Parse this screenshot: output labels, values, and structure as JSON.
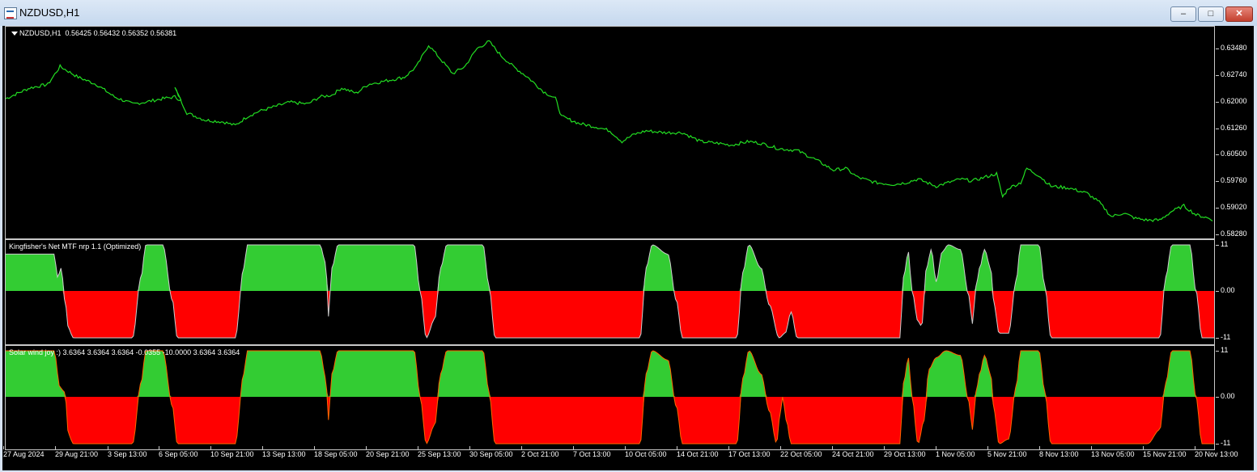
{
  "window": {
    "title": "NZDUSD,H1",
    "controls": {
      "minimize": "–",
      "maximize": "□",
      "close": "✕"
    }
  },
  "main_pane": {
    "label": "NZDUSD,H1",
    "ohlc": "0.56425 0.56432 0.56352 0.56381",
    "line_color": "#22dd22",
    "y_ticks": [
      "0.63480",
      "0.62740",
      "0.62000",
      "0.61260",
      "0.60500",
      "0.59760",
      "0.59020",
      "0.58280"
    ],
    "y_min": 0.5828,
    "y_max": 0.6348
  },
  "indicator1": {
    "label": "Kingfisher's Net MTF nrp 1.1 (Optimized)",
    "y_ticks": [
      "11",
      "0.00",
      "-11"
    ]
  },
  "indicator2": {
    "label": "Solar wind joy :)",
    "values": "3.6364 3.6364 3.6364 -0.0355 -10.0000 3.6364 3.6364",
    "y_ticks": [
      "11",
      "0.00",
      "-11"
    ]
  },
  "colors": {
    "positive": "#33cc33",
    "negative": "#ff0000",
    "edge1": "#cccccc",
    "edge2": "#ff6600"
  },
  "x_labels": [
    "27 Aug 2024",
    "29 Aug 21:00",
    "3 Sep 13:00",
    "6 Sep 05:00",
    "10 Sep 21:00",
    "13 Sep 13:00",
    "18 Sep 05:00",
    "20 Sep 21:00",
    "25 Sep 13:00",
    "30 Sep 05:00",
    "2 Oct 21:00",
    "7 Oct 13:00",
    "10 Oct 05:00",
    "14 Oct 21:00",
    "17 Oct 13:00",
    "22 Oct 05:00",
    "24 Oct 21:00",
    "29 Oct 13:00",
    "1 Nov 05:00",
    "5 Nov 21:00",
    "8 Nov 13:00",
    "13 Nov 05:00",
    "15 Nov 21:00",
    "20 Nov 13:00"
  ],
  "chart_data": [
    {
      "type": "line",
      "series": [
        {
          "name": "NZDUSD,H1",
          "points": [
            [
              0,
              0.621
            ],
            [
              0.02,
              0.624
            ],
            [
              0.035,
              0.625
            ],
            [
              0.045,
              0.63
            ],
            [
              0.06,
              0.627
            ],
            [
              0.075,
              0.625
            ],
            [
              0.09,
              0.6215
            ],
            [
              0.105,
              0.6195
            ],
            [
              0.115,
              0.62
            ],
            [
              0.13,
              0.621
            ],
            [
              0.14,
              0.6215
            ],
            [
              0.145,
              0.6205
            ],
            [
              0.14,
              0.624
            ],
            [
              0.15,
              0.617
            ],
            [
              0.165,
              0.615
            ],
            [
              0.18,
              0.6145
            ],
            [
              0.19,
              0.6135
            ],
            [
              0.2,
              0.616
            ],
            [
              0.21,
              0.6175
            ],
            [
              0.22,
              0.6185
            ],
            [
              0.235,
              0.62
            ],
            [
              0.25,
              0.6195
            ],
            [
              0.26,
              0.6215
            ],
            [
              0.27,
              0.622
            ],
            [
              0.278,
              0.624
            ],
            [
              0.29,
              0.6225
            ],
            [
              0.3,
              0.625
            ],
            [
              0.315,
              0.626
            ],
            [
              0.33,
              0.627
            ],
            [
              0.34,
              0.63
            ],
            [
              0.35,
              0.636
            ],
            [
              0.36,
              0.632
            ],
            [
              0.37,
              0.628
            ],
            [
              0.38,
              0.63
            ],
            [
              0.39,
              0.635
            ],
            [
              0.4,
              0.637
            ],
            [
              0.41,
              0.633
            ],
            [
              0.42,
              0.63
            ],
            [
              0.432,
              0.627
            ],
            [
              0.445,
              0.623
            ],
            [
              0.455,
              0.621
            ],
            [
              0.46,
              0.616
            ],
            [
              0.475,
              0.614
            ],
            [
              0.49,
              0.613
            ],
            [
              0.5,
              0.612
            ],
            [
              0.51,
              0.609
            ],
            [
              0.52,
              0.611
            ],
            [
              0.53,
              0.612
            ],
            [
              0.545,
              0.6115
            ],
            [
              0.56,
              0.6115
            ],
            [
              0.575,
              0.609
            ],
            [
              0.59,
              0.6085
            ],
            [
              0.6,
              0.608
            ],
            [
              0.615,
              0.609
            ],
            [
              0.625,
              0.6085
            ],
            [
              0.64,
              0.607
            ],
            [
              0.655,
              0.6065
            ],
            [
              0.67,
              0.604
            ],
            [
              0.685,
              0.601
            ],
            [
              0.695,
              0.6015
            ],
            [
              0.705,
              0.599
            ],
            [
              0.72,
              0.5975
            ],
            [
              0.735,
              0.597
            ],
            [
              0.745,
              0.5975
            ],
            [
              0.755,
              0.5985
            ],
            [
              0.77,
              0.5965
            ],
            [
              0.78,
              0.5975
            ],
            [
              0.79,
              0.5985
            ],
            [
              0.8,
              0.598
            ],
            [
              0.81,
              0.599
            ],
            [
              0.82,
              0.6
            ],
            [
              0.825,
              0.5935
            ],
            [
              0.83,
              0.596
            ],
            [
              0.84,
              0.5975
            ],
            [
              0.845,
              0.6015
            ],
            [
              0.855,
              0.5995
            ],
            [
              0.865,
              0.5965
            ],
            [
              0.88,
              0.596
            ],
            [
              0.895,
              0.5945
            ],
            [
              0.905,
              0.592
            ],
            [
              0.915,
              0.588
            ],
            [
              0.925,
              0.589
            ],
            [
              0.935,
              0.5875
            ],
            [
              0.945,
              0.587
            ],
            [
              0.955,
              0.587
            ],
            [
              0.965,
              0.5895
            ],
            [
              0.975,
              0.591
            ],
            [
              0.985,
              0.5885
            ],
            [
              0.993,
              0.5878
            ],
            [
              1.0,
              0.587
            ]
          ]
        }
      ]
    },
    {
      "type": "area",
      "title": "Kingfisher's Net MTF nrp 1.1 (Optimized)",
      "ylim": [
        -11,
        11
      ],
      "series": [
        {
          "points": [
            [
              0,
              0.8
            ],
            [
              0.04,
              0.8
            ],
            [
              0.043,
              0.3
            ],
            [
              0.046,
              0.5
            ],
            [
              0.049,
              -0.2
            ],
            [
              0.052,
              -0.8
            ],
            [
              0.056,
              -1
            ],
            [
              0.105,
              -1
            ],
            [
              0.112,
              0.3
            ],
            [
              0.116,
              1
            ],
            [
              0.13,
              1
            ],
            [
              0.138,
              -0.2
            ],
            [
              0.142,
              -1
            ],
            [
              0.19,
              -1
            ],
            [
              0.197,
              0.5
            ],
            [
              0.2,
              1
            ],
            [
              0.26,
              1
            ],
            [
              0.265,
              0.6
            ],
            [
              0.267,
              -0.55
            ],
            [
              0.27,
              0.5
            ],
            [
              0.275,
              1
            ],
            [
              0.338,
              1
            ],
            [
              0.343,
              0
            ],
            [
              0.348,
              -1
            ],
            [
              0.355,
              -0.6
            ],
            [
              0.36,
              0.5
            ],
            [
              0.365,
              1
            ],
            [
              0.395,
              1
            ],
            [
              0.4,
              0.1
            ],
            [
              0.405,
              -1
            ],
            [
              0.525,
              -1
            ],
            [
              0.53,
              0.5
            ],
            [
              0.535,
              1
            ],
            [
              0.548,
              0.8
            ],
            [
              0.555,
              -0.2
            ],
            [
              0.56,
              -1
            ],
            [
              0.605,
              -1
            ],
            [
              0.61,
              0.4
            ],
            [
              0.615,
              1
            ],
            [
              0.625,
              0.5
            ],
            [
              0.632,
              -0.3
            ],
            [
              0.64,
              -1
            ],
            [
              0.645,
              -0.9
            ],
            [
              0.65,
              -0.45
            ],
            [
              0.655,
              -1
            ],
            [
              0.74,
              -1
            ],
            [
              0.743,
              0.3
            ],
            [
              0.747,
              0.85
            ],
            [
              0.75,
              0
            ],
            [
              0.755,
              -0.65
            ],
            [
              0.758,
              -0.75
            ],
            [
              0.762,
              0.5
            ],
            [
              0.766,
              0.9
            ],
            [
              0.77,
              0.2
            ],
            [
              0.775,
              0.85
            ],
            [
              0.78,
              1
            ],
            [
              0.79,
              0.9
            ],
            [
              0.797,
              -0.1
            ],
            [
              0.8,
              -0.7
            ],
            [
              0.803,
              0.1
            ],
            [
              0.806,
              0.5
            ],
            [
              0.81,
              0.9
            ],
            [
              0.815,
              0.5
            ],
            [
              0.818,
              -0.3
            ],
            [
              0.822,
              -0.9
            ],
            [
              0.83,
              -0.9
            ],
            [
              0.836,
              0.2
            ],
            [
              0.84,
              1
            ],
            [
              0.855,
              1
            ],
            [
              0.86,
              0.1
            ],
            [
              0.865,
              -1
            ],
            [
              0.955,
              -1
            ],
            [
              0.96,
              0.3
            ],
            [
              0.965,
              1
            ],
            [
              0.98,
              1
            ],
            [
              0.985,
              0
            ],
            [
              0.99,
              -1
            ],
            [
              1.0,
              -1
            ]
          ]
        }
      ]
    },
    {
      "type": "area",
      "title": "Solar wind joy :)",
      "ylim": [
        -11,
        11
      ],
      "series": [
        {
          "points": [
            [
              0,
              1
            ],
            [
              0.04,
              1
            ],
            [
              0.045,
              0.2
            ],
            [
              0.049,
              0.1
            ],
            [
              0.052,
              -0.8
            ],
            [
              0.056,
              -1
            ],
            [
              0.105,
              -1
            ],
            [
              0.112,
              0.3
            ],
            [
              0.116,
              1
            ],
            [
              0.13,
              1
            ],
            [
              0.138,
              -0.2
            ],
            [
              0.142,
              -1
            ],
            [
              0.19,
              -1
            ],
            [
              0.197,
              0.5
            ],
            [
              0.2,
              1
            ],
            [
              0.26,
              1
            ],
            [
              0.265,
              0.4
            ],
            [
              0.267,
              -0.5
            ],
            [
              0.27,
              0.5
            ],
            [
              0.275,
              1
            ],
            [
              0.338,
              1
            ],
            [
              0.343,
              0
            ],
            [
              0.348,
              -1
            ],
            [
              0.355,
              -0.6
            ],
            [
              0.36,
              0.5
            ],
            [
              0.365,
              1
            ],
            [
              0.395,
              1
            ],
            [
              0.4,
              0.1
            ],
            [
              0.405,
              -1
            ],
            [
              0.525,
              -1
            ],
            [
              0.53,
              0.5
            ],
            [
              0.535,
              1
            ],
            [
              0.548,
              0.8
            ],
            [
              0.555,
              -0.2
            ],
            [
              0.56,
              -1
            ],
            [
              0.605,
              -1
            ],
            [
              0.61,
              0.4
            ],
            [
              0.615,
              1
            ],
            [
              0.625,
              0.5
            ],
            [
              0.632,
              -0.3
            ],
            [
              0.638,
              -1
            ],
            [
              0.64,
              -0.5
            ],
            [
              0.643,
              0
            ],
            [
              0.646,
              -0.5
            ],
            [
              0.65,
              -1
            ],
            [
              0.74,
              -1
            ],
            [
              0.743,
              0.3
            ],
            [
              0.747,
              0.85
            ],
            [
              0.75,
              0
            ],
            [
              0.755,
              -1
            ],
            [
              0.76,
              -0.5
            ],
            [
              0.764,
              0.6
            ],
            [
              0.77,
              0.85
            ],
            [
              0.778,
              1
            ],
            [
              0.79,
              0.9
            ],
            [
              0.797,
              -0.1
            ],
            [
              0.8,
              -0.7
            ],
            [
              0.803,
              0.1
            ],
            [
              0.806,
              0.5
            ],
            [
              0.81,
              0.9
            ],
            [
              0.815,
              0.5
            ],
            [
              0.818,
              -0.3
            ],
            [
              0.822,
              -1
            ],
            [
              0.83,
              -0.9
            ],
            [
              0.836,
              0.2
            ],
            [
              0.84,
              1
            ],
            [
              0.855,
              1
            ],
            [
              0.86,
              0.1
            ],
            [
              0.865,
              -1
            ],
            [
              0.945,
              -1
            ],
            [
              0.955,
              -0.7
            ],
            [
              0.96,
              0.3
            ],
            [
              0.965,
              1
            ],
            [
              0.98,
              1
            ],
            [
              0.985,
              0
            ],
            [
              0.99,
              -1
            ],
            [
              1.0,
              -1
            ]
          ]
        }
      ]
    }
  ]
}
